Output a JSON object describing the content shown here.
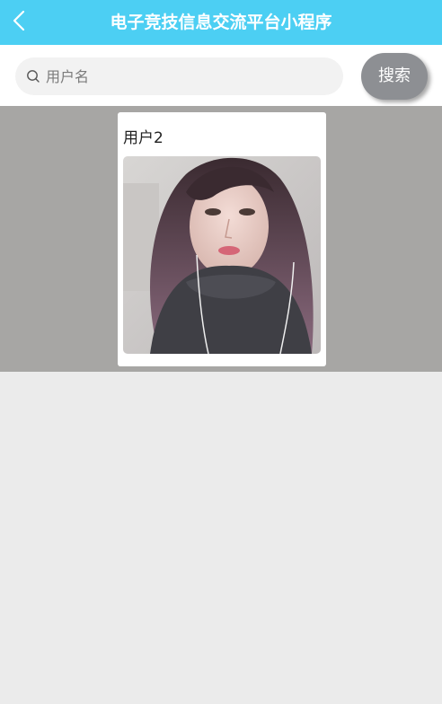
{
  "header": {
    "title": "电子竞技信息交流平台小程序",
    "background_color": "#4ccff3"
  },
  "search": {
    "placeholder": "用户名",
    "value": "",
    "button_label": "搜索"
  },
  "results": [
    {
      "name": "用户2",
      "photo_description": "portrait photo of a woman with long hair wearing a dark fuzzy scarf"
    }
  ],
  "colors": {
    "accent": "#4ccff3",
    "search_button": "#8d8f93",
    "results_band": "#a7a6a4",
    "page_background": "#ebebeb"
  }
}
